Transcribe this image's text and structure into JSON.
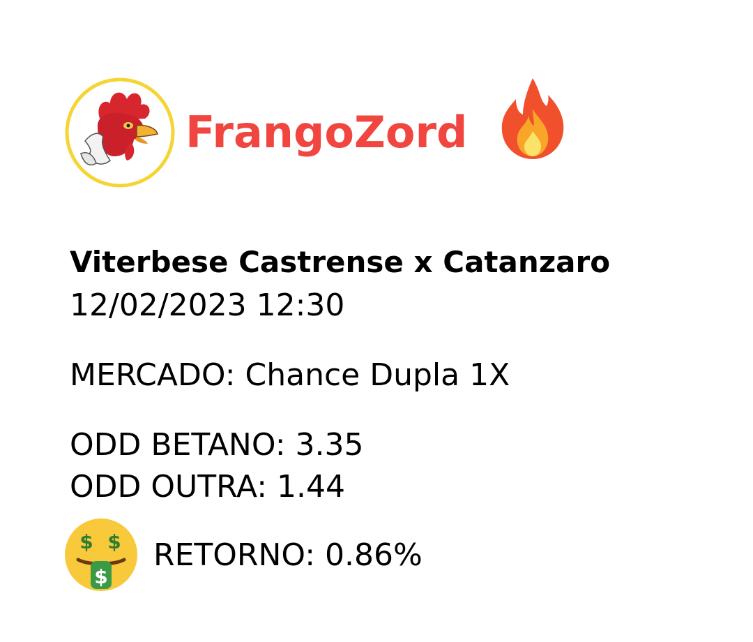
{
  "brand": {
    "name": "FrangoZord",
    "logo_icon": "rooster-logo-icon",
    "accent_icon": "fire-icon",
    "brand_color": "#f0463f",
    "logo_ring_color": "#f5d535"
  },
  "match": {
    "teams": "Viterbese Castrense x Catanzaro",
    "datetime": "12/02/2023 12:30"
  },
  "market": {
    "text": "MERCADO: Chance Dupla 1X"
  },
  "odds": {
    "betano": "ODD BETANO: 3.35",
    "outra": "ODD OUTRA: 1.44"
  },
  "return": {
    "icon": "money-mouth-face-icon",
    "text": "RETORNO: 0.86%"
  }
}
